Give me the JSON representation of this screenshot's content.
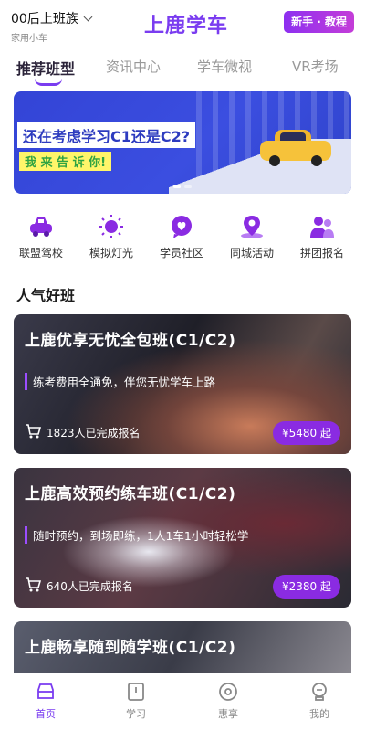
{
  "header": {
    "location": "00后上班族",
    "location_sub": "家用小车",
    "logo": "上鹿学车",
    "newbie_button": "新手 · 教程"
  },
  "tabs": [
    {
      "label": "推荐班型",
      "active": true
    },
    {
      "label": "资讯中心",
      "active": false
    },
    {
      "label": "学车微视",
      "active": false
    },
    {
      "label": "VR考场",
      "active": false
    }
  ],
  "banner": {
    "title": "还在考虑学习C1还是C2?",
    "subtitle": "我 来 告 诉 你!"
  },
  "quick_menu": [
    {
      "label": "联盟驾校",
      "icon": "car-icon"
    },
    {
      "label": "模拟灯光",
      "icon": "light-icon"
    },
    {
      "label": "学员社区",
      "icon": "heart-chat-icon"
    },
    {
      "label": "同城活动",
      "icon": "location-pin-icon"
    },
    {
      "label": "拼团报名",
      "icon": "group-icon"
    }
  ],
  "section": {
    "title": "人气好班"
  },
  "cards": [
    {
      "title": "上鹿优享无忧全包班(C1/C2)",
      "desc": "练考费用全通免，伴您无忧学车上路",
      "count": "1823人已完成报名",
      "price": "¥5480 起"
    },
    {
      "title": "上鹿高效预约练车班(C1/C2)",
      "desc": "随时预约，到场即练，1人1车1小时轻松学",
      "count": "640人已完成报名",
      "price": "¥2380 起"
    },
    {
      "title": "上鹿畅享随到随学班(C1/C2)",
      "desc": "",
      "count": "",
      "price": ""
    }
  ],
  "bottom_nav": [
    {
      "label": "首页",
      "active": true
    },
    {
      "label": "学习",
      "active": false
    },
    {
      "label": "惠享",
      "active": false
    },
    {
      "label": "我的",
      "active": false
    }
  ],
  "colors": {
    "accent": "#7a3cf0",
    "price_bg": "#8a2be2",
    "banner_bg": "#3344d6"
  }
}
